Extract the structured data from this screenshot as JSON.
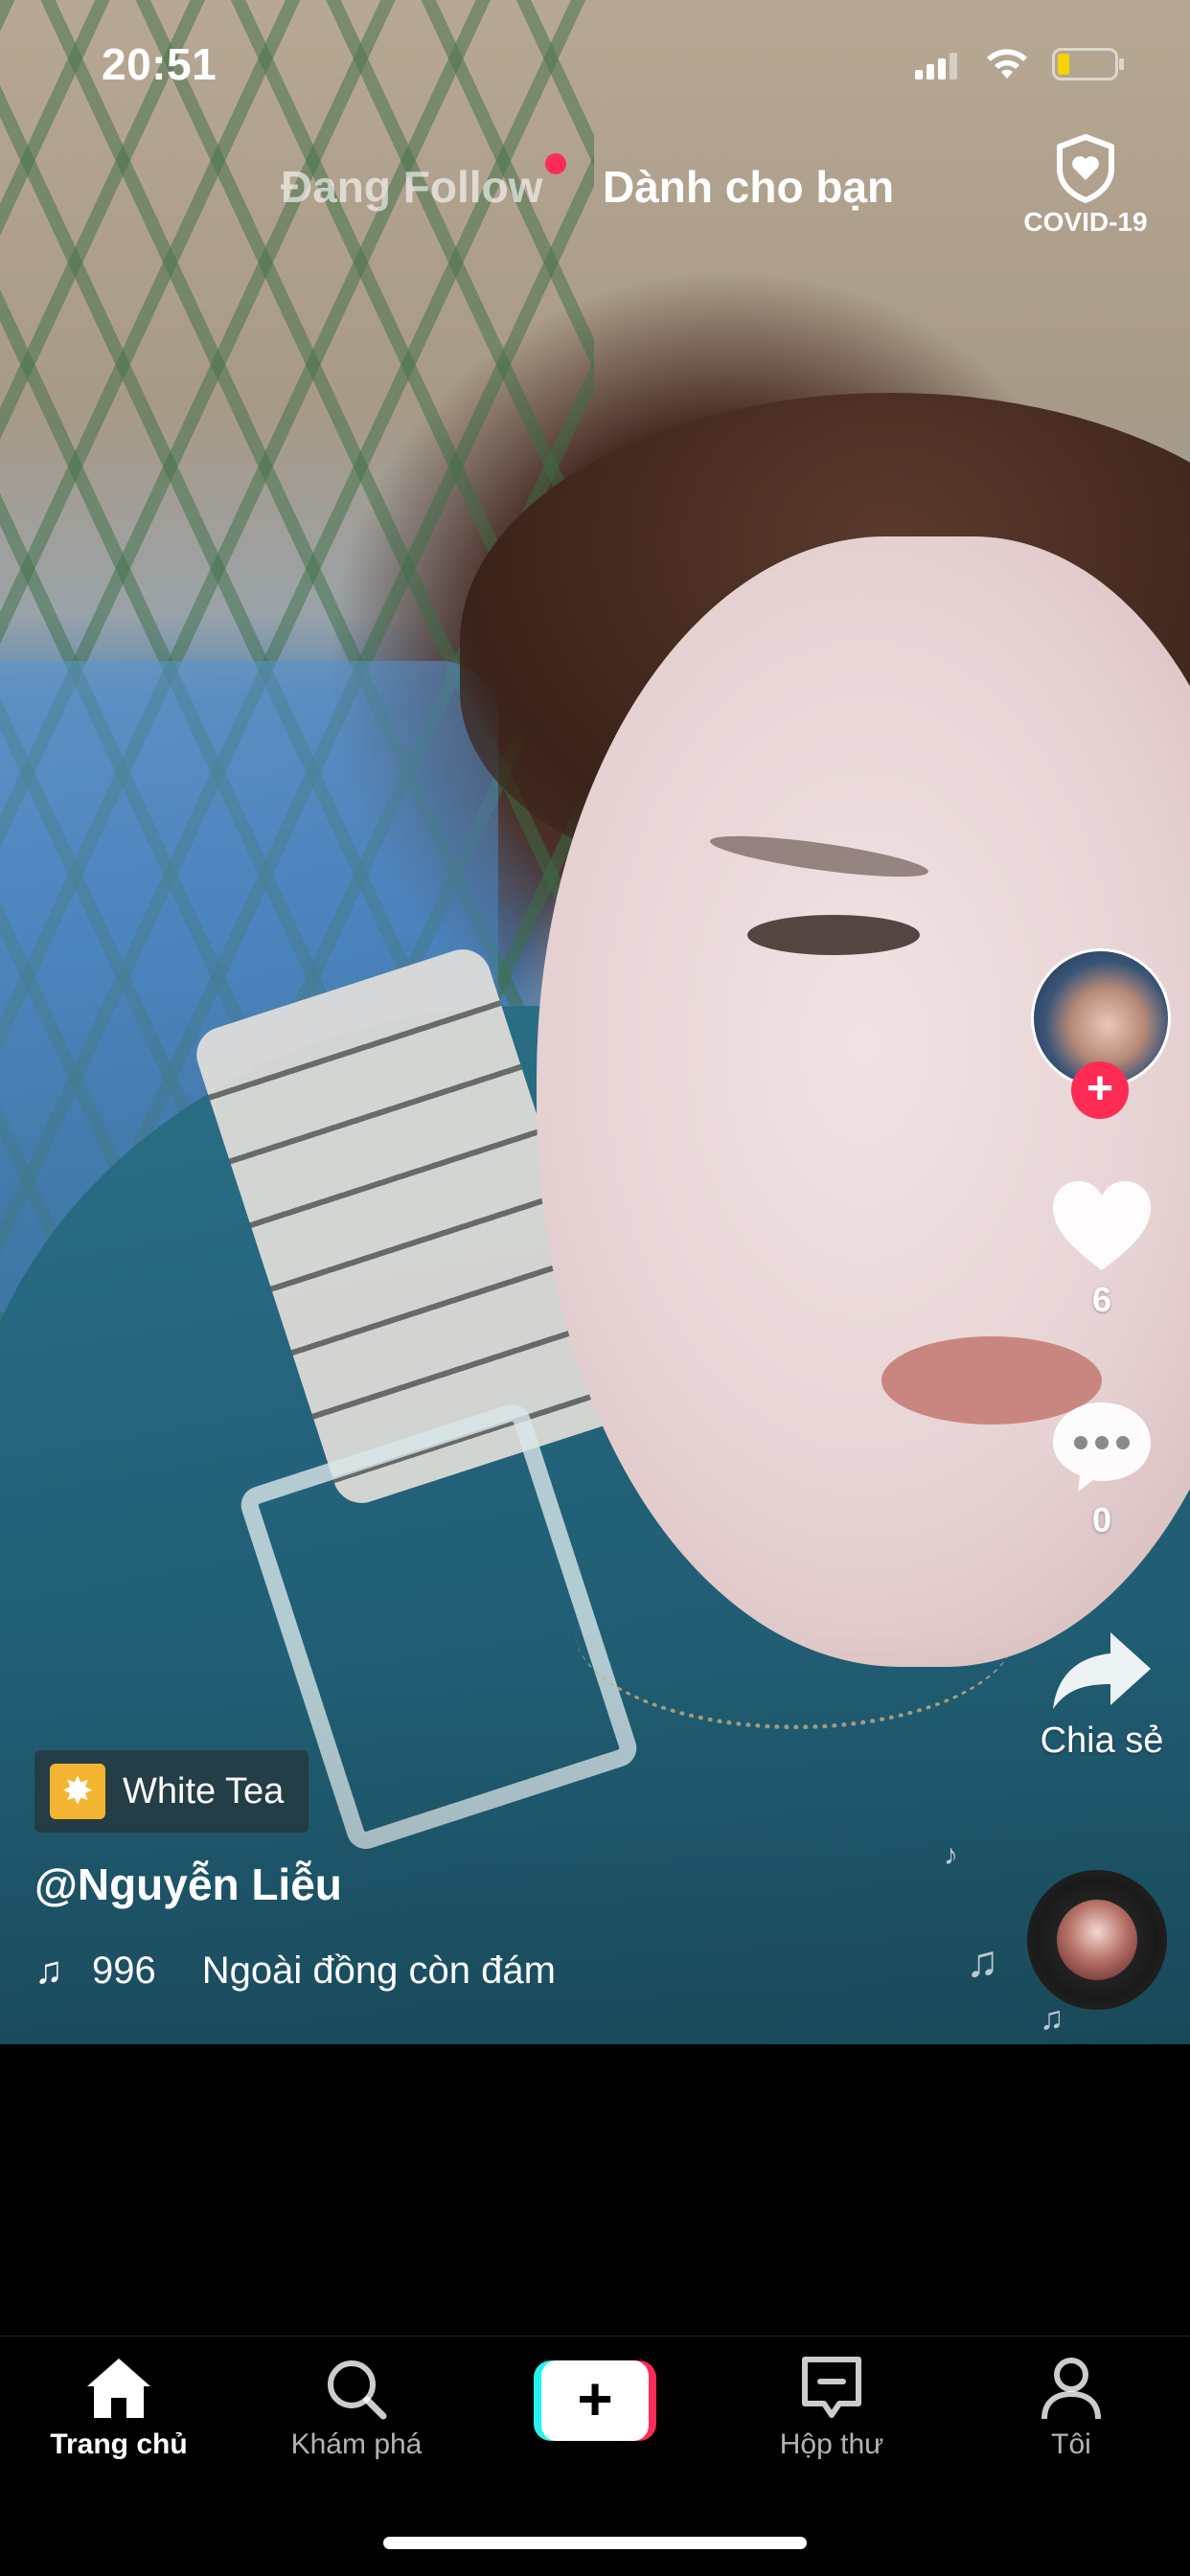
{
  "status_bar": {
    "time": "20:51"
  },
  "top_nav": {
    "following_label": "Đang Follow",
    "for_you_label": "Dành cho bạn",
    "covid_label": "COVID-19"
  },
  "actions": {
    "like_count": "6",
    "comment_count": "0",
    "share_label": "Chia sẻ"
  },
  "video_info": {
    "effect_name": "White Tea",
    "username": "@Nguyễn Liễu",
    "music_prefix": "996",
    "music_title": "Ngoài đồng còn đám"
  },
  "tab_bar": {
    "home": "Trang chủ",
    "discover": "Khám phá",
    "create": "+",
    "inbox": "Hộp thư",
    "me": "Tôi"
  },
  "colors": {
    "accent_red": "#fe2c55",
    "accent_cyan": "#25f4ee",
    "effect_yellow": "#f3b531",
    "background": "#000000"
  },
  "icons": [
    "signal-icon",
    "wifi-icon",
    "battery-icon",
    "shield-heart-icon",
    "heart-icon",
    "comment-icon",
    "share-arrow-icon",
    "music-note-icon",
    "home-icon",
    "search-icon",
    "inbox-icon",
    "profile-icon",
    "plus-icon"
  ]
}
